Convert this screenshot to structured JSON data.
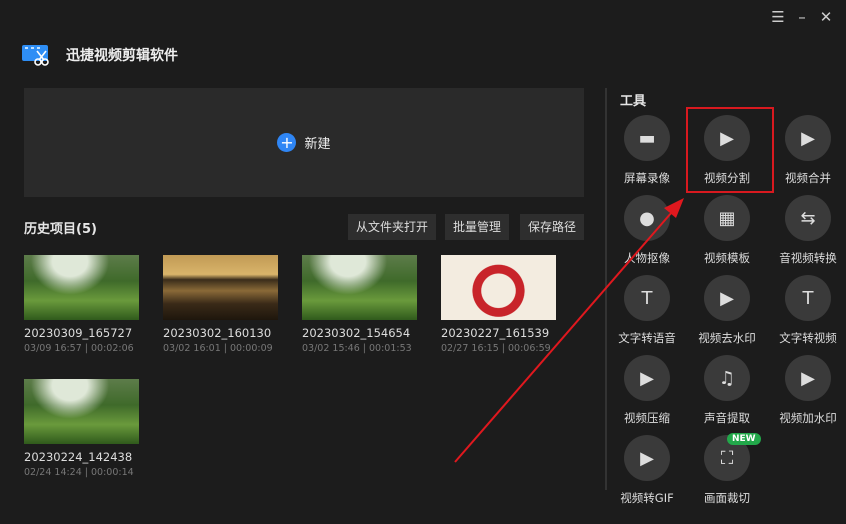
{
  "window": {
    "title": "迅捷视频剪辑软件",
    "menu_icon": "menu-icon",
    "minimize_icon": "minimize-icon",
    "close_icon": "close-icon"
  },
  "new_project": {
    "label": "新建"
  },
  "history": {
    "title": "历史项目(5)",
    "buttons": [
      "从文件夹打开",
      "批量管理",
      "保存路径"
    ],
    "items": [
      {
        "name": "20230309_165727",
        "meta": "03/09 16:57 | 00:02:06",
        "thumb": "grass"
      },
      {
        "name": "20230302_160130",
        "meta": "03/02 16:01 | 00:00:09",
        "thumb": "sea"
      },
      {
        "name": "20230302_154654",
        "meta": "03/02 15:46 | 00:01:53",
        "thumb": "grass"
      },
      {
        "name": "20230227_161539",
        "meta": "02/27 16:15 | 00:06:59",
        "thumb": "fest"
      },
      {
        "name": "20230224_142438",
        "meta": "02/24 14:24 | 00:00:14",
        "thumb": "grass"
      }
    ]
  },
  "tools": {
    "title": "工具",
    "badge": "NEW",
    "items": [
      {
        "label": "屏幕录像",
        "icon": "screen-record-icon",
        "glyph": "▬"
      },
      {
        "label": "视频分割",
        "icon": "video-split-icon",
        "glyph": "▶"
      },
      {
        "label": "视频合并",
        "icon": "video-merge-icon",
        "glyph": "▶"
      },
      {
        "label": "人物抠像",
        "icon": "portrait-cutout-icon",
        "glyph": "●"
      },
      {
        "label": "视频模板",
        "icon": "video-template-icon",
        "glyph": "▦"
      },
      {
        "label": "音视频转换",
        "icon": "av-convert-icon",
        "glyph": "⇆"
      },
      {
        "label": "文字转语音",
        "icon": "text-to-speech-icon",
        "glyph": "T"
      },
      {
        "label": "视频去水印",
        "icon": "remove-watermark-icon",
        "glyph": "▶"
      },
      {
        "label": "文字转视频",
        "icon": "text-to-video-icon",
        "glyph": "T"
      },
      {
        "label": "视频压缩",
        "icon": "video-compress-icon",
        "glyph": "▶"
      },
      {
        "label": "声音提取",
        "icon": "audio-extract-icon",
        "glyph": "♫"
      },
      {
        "label": "视频加水印",
        "icon": "add-watermark-icon",
        "glyph": "▶"
      },
      {
        "label": "视频转GIF",
        "icon": "video-to-gif-icon",
        "glyph": "▶"
      },
      {
        "label": "画面裁切",
        "icon": "crop-icon",
        "glyph": "⛶"
      }
    ]
  }
}
